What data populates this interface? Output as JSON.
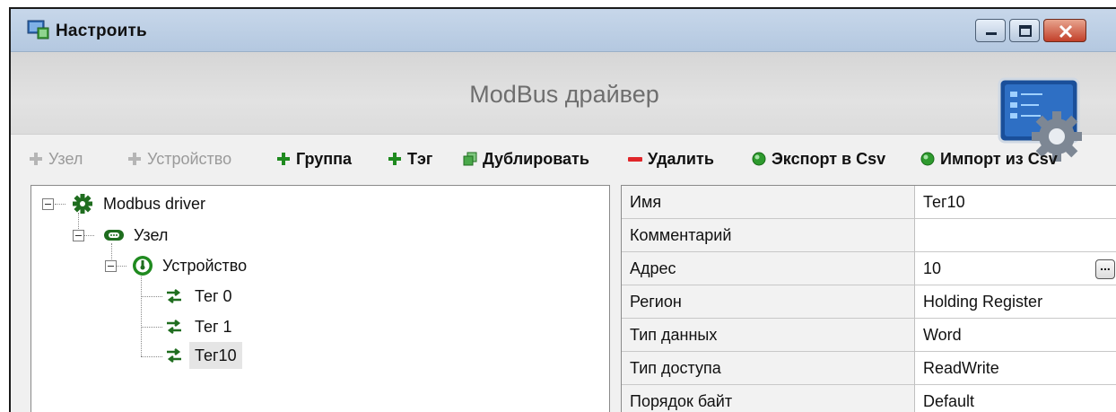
{
  "window": {
    "title": "Настроить"
  },
  "header": {
    "title": "ModBus драйвер"
  },
  "toolbar": {
    "node": "Узел",
    "device": "Устройство",
    "group": "Группа",
    "tag": "Тэг",
    "duplicate": "Дублировать",
    "delete": "Удалить",
    "export": "Экспорт в Csv",
    "import": "Импорт из Csv"
  },
  "tree": {
    "root": "Modbus driver",
    "node": "Узел",
    "device": "Устройство",
    "tags": [
      "Тег 0",
      "Тег 1",
      "Тег10"
    ]
  },
  "properties": [
    {
      "name": "Имя",
      "value": "Тег10"
    },
    {
      "name": "Комментарий",
      "value": ""
    },
    {
      "name": "Адрес",
      "value": "10"
    },
    {
      "name": "Регион",
      "value": "Holding Register"
    },
    {
      "name": "Тип данных",
      "value": "Word"
    },
    {
      "name": "Тип доступа",
      "value": "ReadWrite"
    },
    {
      "name": "Порядок байт",
      "value": "Default"
    }
  ],
  "ellipsis_label": "...",
  "colors": {
    "accent_green": "#1f8a1f",
    "delete_red": "#e0262a",
    "titlebar": "#c7d7ea",
    "selection": "#e5e5e5"
  },
  "icons": {
    "app": "settings-app-icon",
    "header": "modbus-gear-panel-icon",
    "root": "gear-icon",
    "node": "serial-port-icon",
    "device": "gauge-icon",
    "tag": "transfer-arrows-icon"
  }
}
